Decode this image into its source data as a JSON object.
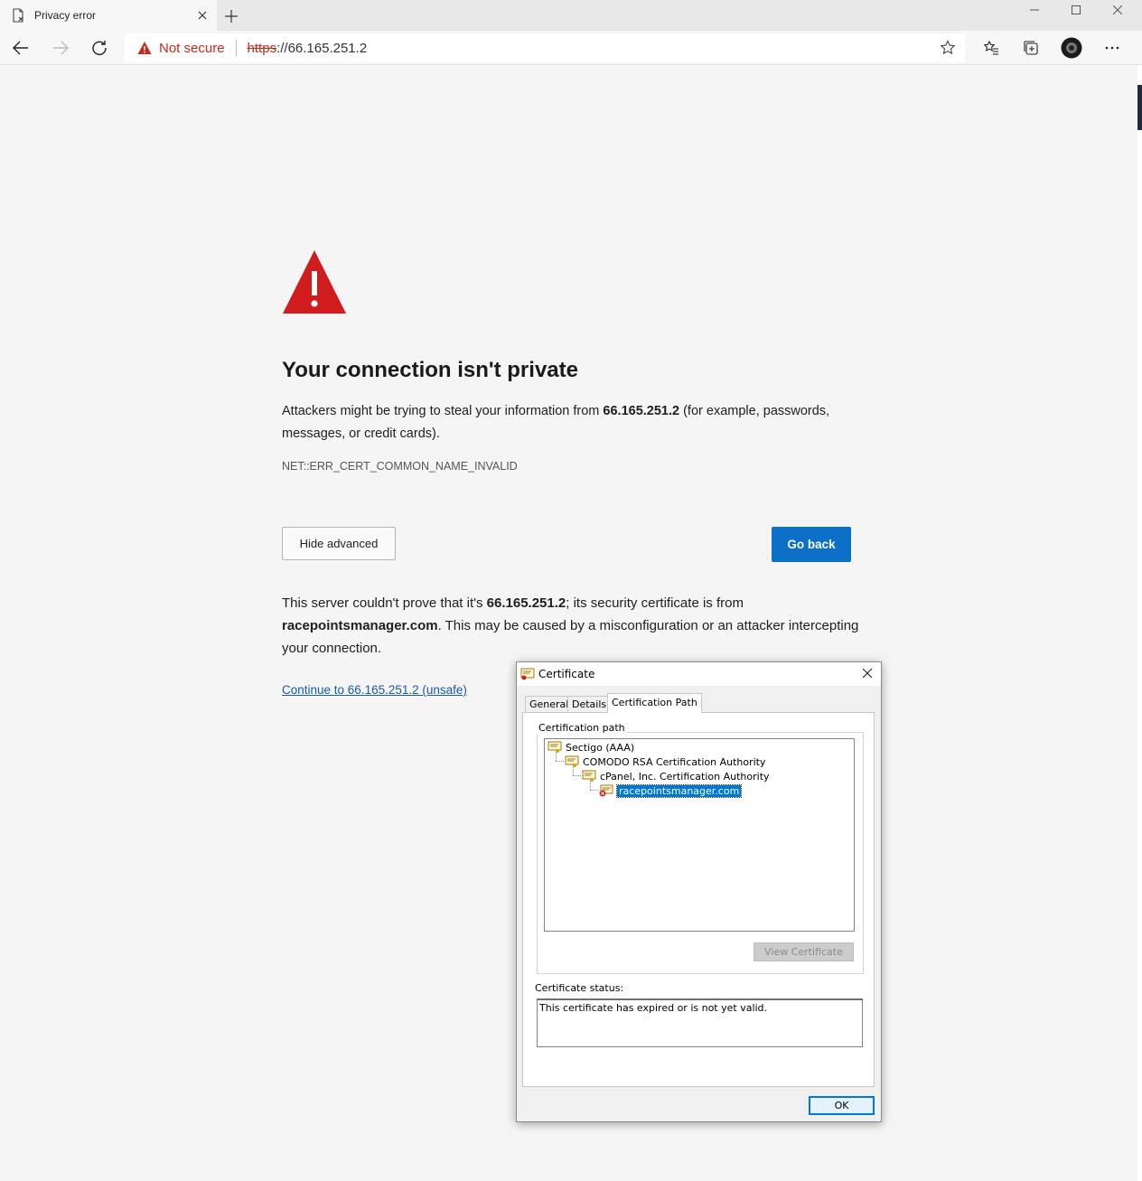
{
  "browser": {
    "tab_title": "Privacy error",
    "omnibox": {
      "security_label": "Not secure",
      "url_scheme": "https",
      "url_rest": "://66.165.251.2"
    }
  },
  "page": {
    "title": "Your connection isn't private",
    "intro_1": "Attackers might be trying to steal your information from ",
    "intro_host": "66.165.251.2",
    "intro_2": " (for example, passwords, messages, or credit cards).",
    "error_code": "NET::ERR_CERT_COMMON_NAME_INVALID",
    "hide_advanced_label": "Hide advanced",
    "go_back_label": "Go back",
    "detail_1": "This server couldn't prove that it's ",
    "detail_host": "66.165.251.2",
    "detail_2": "; its security certificate is from ",
    "detail_domain": "racepointsmanager.com",
    "detail_3": ". This may be caused by a misconfiguration or an attacker intercepting your connection.",
    "continue_link": "Continue to 66.165.251.2 (unsafe)"
  },
  "dialog": {
    "title": "Certificate",
    "tabs": [
      "General",
      "Details",
      "Certification Path"
    ],
    "active_tab": "Certification Path",
    "path_group_label": "Certification path",
    "path": [
      "Sectigo (AAA)",
      "COMODO RSA Certification Authority",
      "cPanel, Inc. Certification Authority",
      "racepointsmanager.com"
    ],
    "view_certificate_label": "View Certificate",
    "status_label": "Certificate status:",
    "status_text": "This certificate has expired or is not yet valid.",
    "ok_label": "OK"
  },
  "colors": {
    "danger": "#c42b1c",
    "primary_button": "#0c6fc8",
    "link": "#1a5aa8",
    "selection": "#0078d7"
  }
}
